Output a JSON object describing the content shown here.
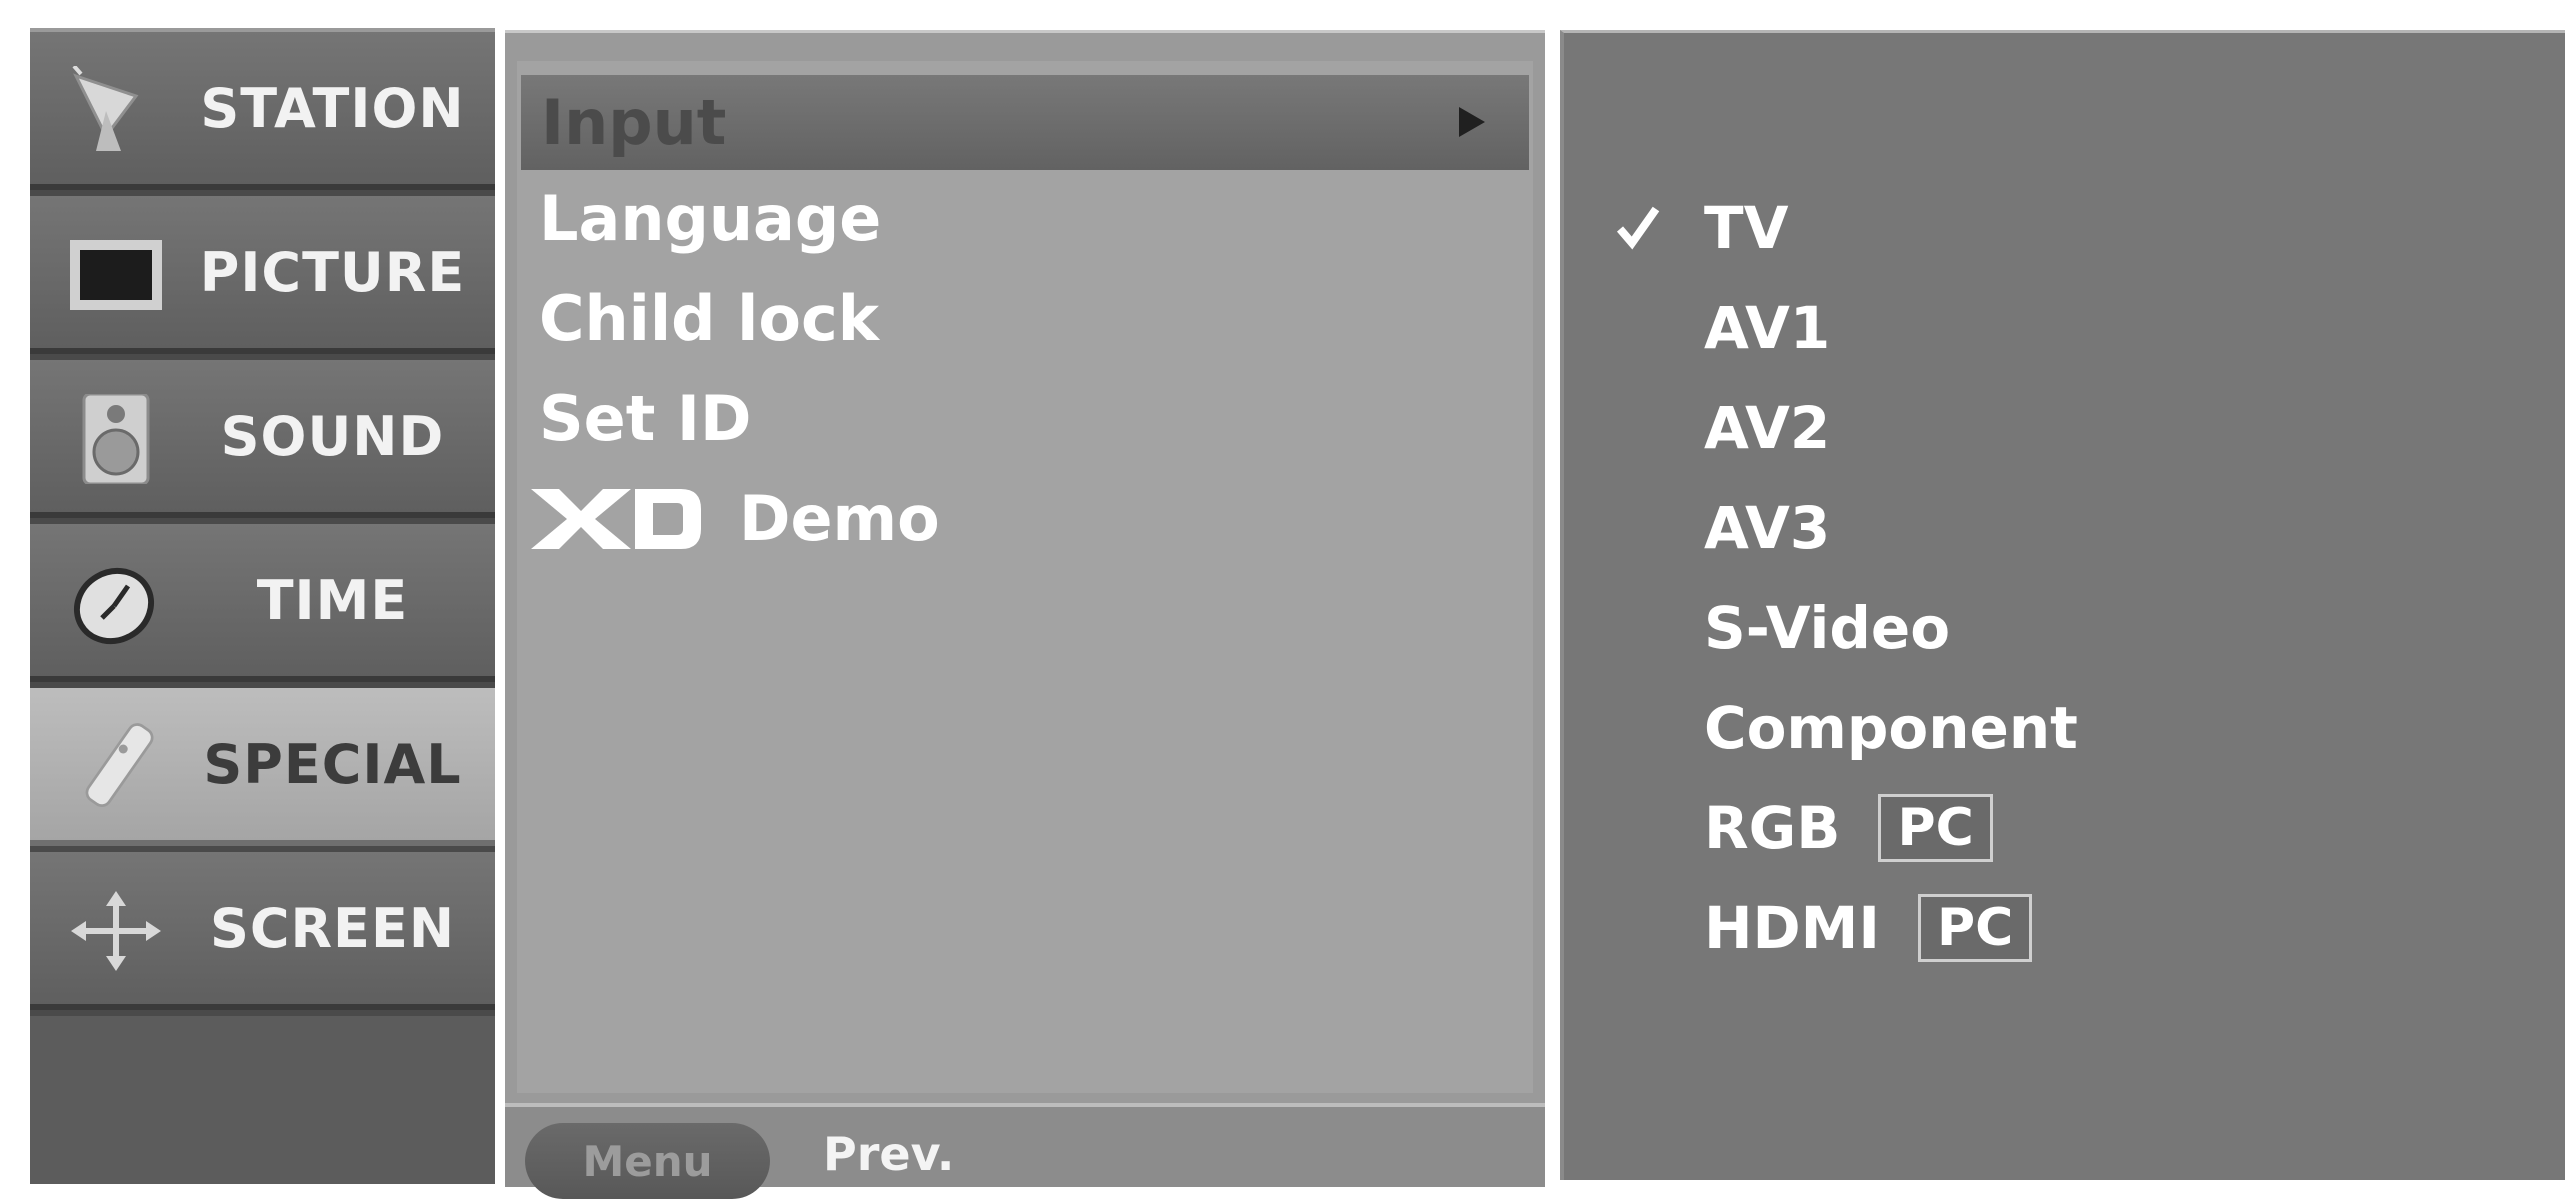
{
  "categories": [
    {
      "label": "STATION",
      "icon": "satellite-dish-icon",
      "selected": false
    },
    {
      "label": "PICTURE",
      "icon": "tv-screen-icon",
      "selected": false
    },
    {
      "label": "SOUND",
      "icon": "speaker-icon",
      "selected": false
    },
    {
      "label": "TIME",
      "icon": "clock-icon",
      "selected": false
    },
    {
      "label": "SPECIAL",
      "icon": "remote-control-icon",
      "selected": true
    },
    {
      "label": "SCREEN",
      "icon": "move-arrows-icon",
      "selected": false
    }
  ],
  "menu": {
    "items": [
      {
        "label": "Input",
        "selected": true,
        "has_submenu": true
      },
      {
        "label": "Language"
      },
      {
        "label": "Child lock"
      },
      {
        "label": "Set ID"
      },
      {
        "label": "Demo",
        "logo": "XD"
      }
    ],
    "footer": {
      "button_label": "Menu",
      "prev_label": "Prev."
    }
  },
  "options": {
    "items": [
      {
        "label": "TV",
        "checked": true
      },
      {
        "label": "AV1"
      },
      {
        "label": "AV2"
      },
      {
        "label": "AV3"
      },
      {
        "label": "S-Video"
      },
      {
        "label": "Component"
      },
      {
        "label": "RGB",
        "tag": "PC"
      },
      {
        "label": "HDMI",
        "tag": "PC"
      }
    ]
  },
  "colors": {
    "selected_category_bg": "#b5b5b5",
    "menu_bg": "#a3a3a3",
    "option_bg": "#777777",
    "text": "#ffffff"
  }
}
